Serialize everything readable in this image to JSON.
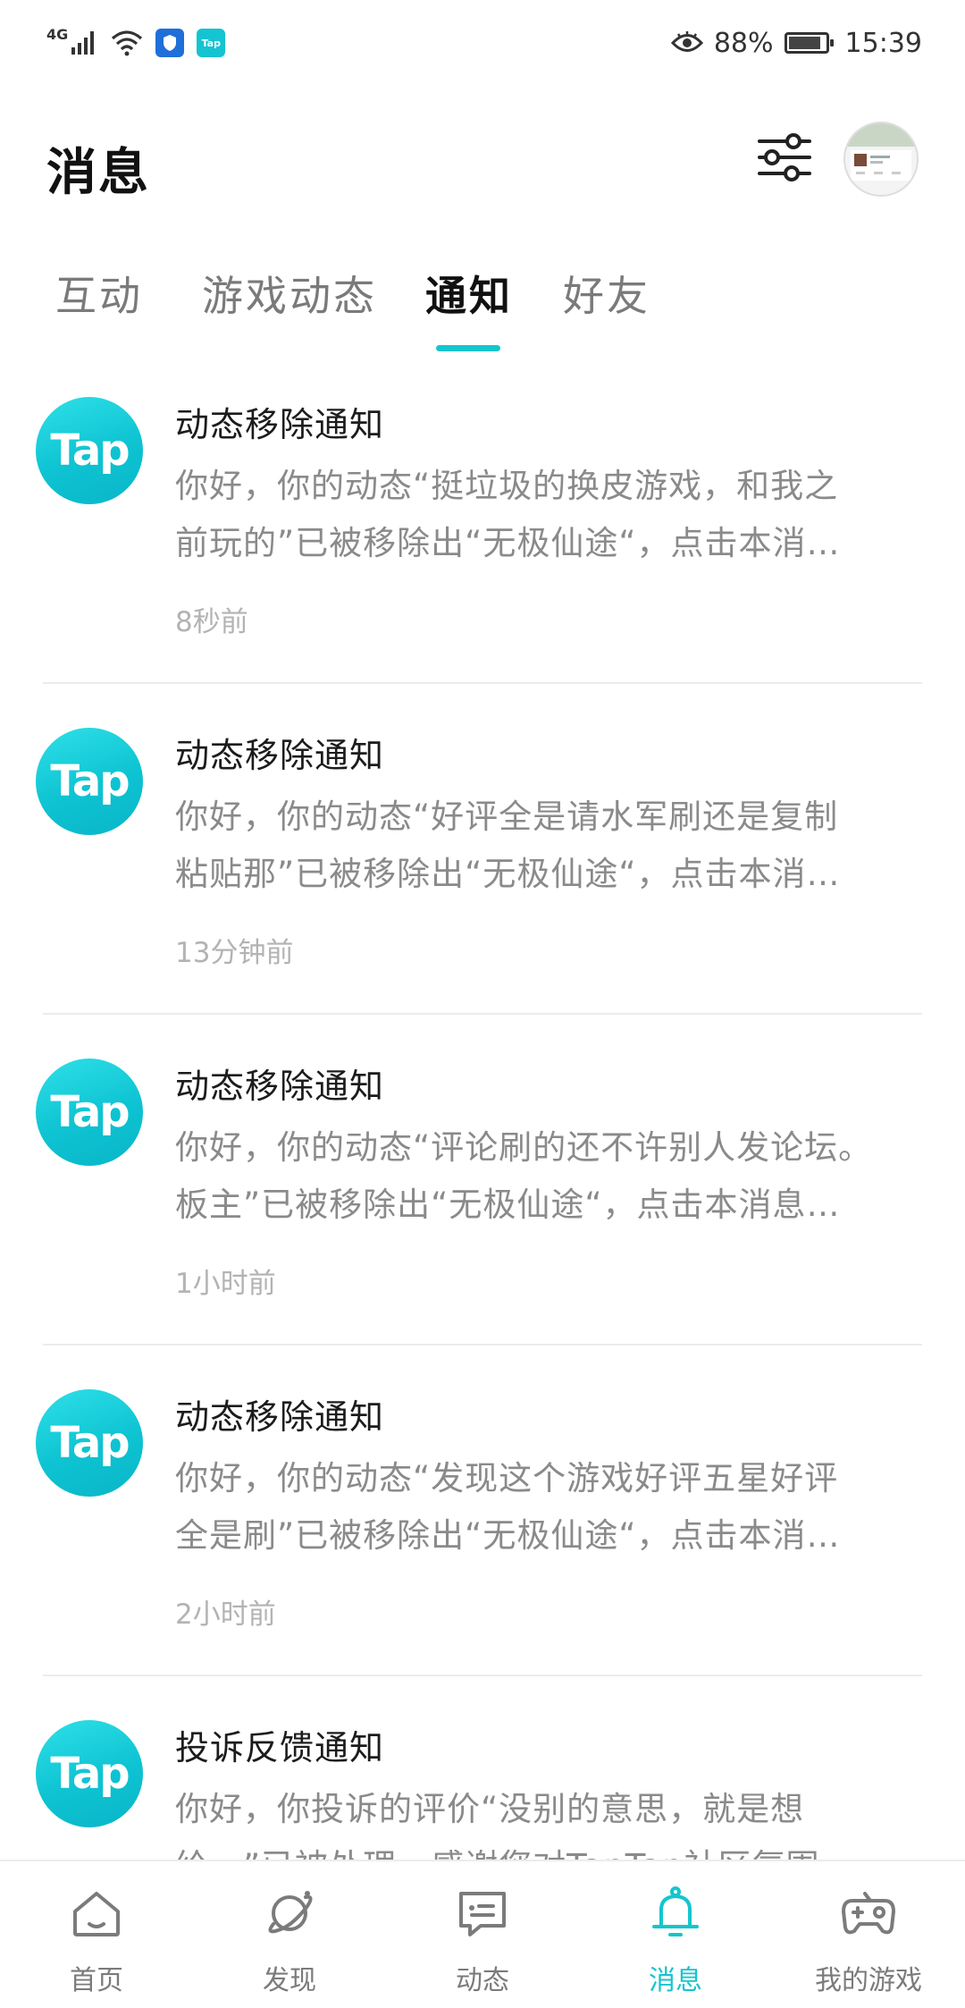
{
  "status_bar": {
    "network": "4G",
    "tap_badge": "Tap",
    "battery_percent": "88%",
    "battery_level": 0.88,
    "time": "15:39"
  },
  "header": {
    "title": "消息"
  },
  "tabs": [
    {
      "label": "互动",
      "active": false
    },
    {
      "label": "游戏动态",
      "active": false
    },
    {
      "label": "通知",
      "active": true
    },
    {
      "label": "好友",
      "active": false
    }
  ],
  "notifications": [
    {
      "icon_text": "Tap",
      "title": "动态移除通知",
      "body_line1": "你好，你的动态“挺垃圾的换皮游戏，和我之",
      "body_line2": "前玩的”已被移除出“无极仙途“，点击本消…",
      "time": "8秒前"
    },
    {
      "icon_text": "Tap",
      "title": "动态移除通知",
      "body_line1": "你好，你的动态“好评全是请水军刷还是复制",
      "body_line2": "粘贴那”已被移除出“无极仙途“，点击本消…",
      "time": "13分钟前"
    },
    {
      "icon_text": "Tap",
      "title": "动态移除通知",
      "body_line1": "你好，你的动态“评论刷的还不许别人发论坛。",
      "body_line2": "板主”已被移除出“无极仙途“，点击本消息…",
      "time": "1小时前"
    },
    {
      "icon_text": "Tap",
      "title": "动态移除通知",
      "body_line1": "你好，你的动态“发现这个游戏好评五星好评",
      "body_line2": "全是刷”已被移除出“无极仙途“，点击本消…",
      "time": "2小时前"
    },
    {
      "icon_text": "Tap",
      "title": "投诉反馈通知",
      "body_line1": "你好，你投诉的评价“没别的意思，就是想",
      "body_line2": "给…”已被处理，感谢您对TapTap社区氛围",
      "time": ""
    }
  ],
  "bottom_nav": [
    {
      "label": "首页",
      "icon": "home-icon",
      "active": false
    },
    {
      "label": "发现",
      "icon": "planet-icon",
      "active": false
    },
    {
      "label": "动态",
      "icon": "chat-icon",
      "active": false
    },
    {
      "label": "消息",
      "icon": "bell-icon",
      "active": true
    },
    {
      "label": "我的游戏",
      "icon": "gamepad-icon",
      "active": false
    }
  ],
  "colors": {
    "accent": "#15c5ce",
    "text_primary": "#1c1c1c",
    "text_secondary": "#8a8a8a",
    "text_muted": "#b3b3b3"
  }
}
